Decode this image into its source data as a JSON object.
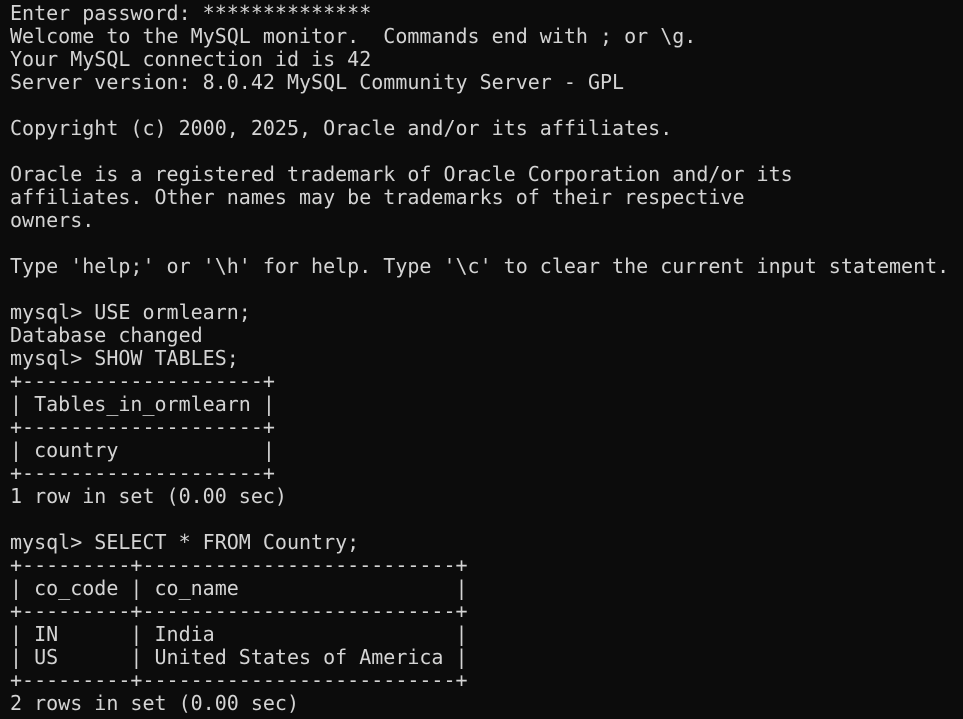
{
  "terminal": {
    "lines": [
      "Enter password: **************",
      "Welcome to the MySQL monitor.  Commands end with ; or \\g.",
      "Your MySQL connection id is 42",
      "Server version: 8.0.42 MySQL Community Server - GPL",
      "",
      "Copyright (c) 2000, 2025, Oracle and/or its affiliates.",
      "",
      "Oracle is a registered trademark of Oracle Corporation and/or its",
      "affiliates. Other names may be trademarks of their respective",
      "owners.",
      "",
      "Type 'help;' or '\\h' for help. Type '\\c' to clear the current input statement.",
      "",
      "mysql> USE ormlearn;",
      "Database changed",
      "mysql> SHOW TABLES;",
      "+--------------------+",
      "| Tables_in_ormlearn |",
      "+--------------------+",
      "| country            |",
      "+--------------------+",
      "1 row in set (0.00 sec)",
      "",
      "mysql> SELECT * FROM Country;",
      "+---------+--------------------------+",
      "| co_code | co_name                  |",
      "+---------+--------------------------+",
      "| IN      | India                    |",
      "| US      | United States of America |",
      "+---------+--------------------------+",
      "2 rows in set (0.00 sec)"
    ]
  },
  "colors": {
    "background": "#0c0c0c",
    "foreground": "#d4d4d4"
  }
}
